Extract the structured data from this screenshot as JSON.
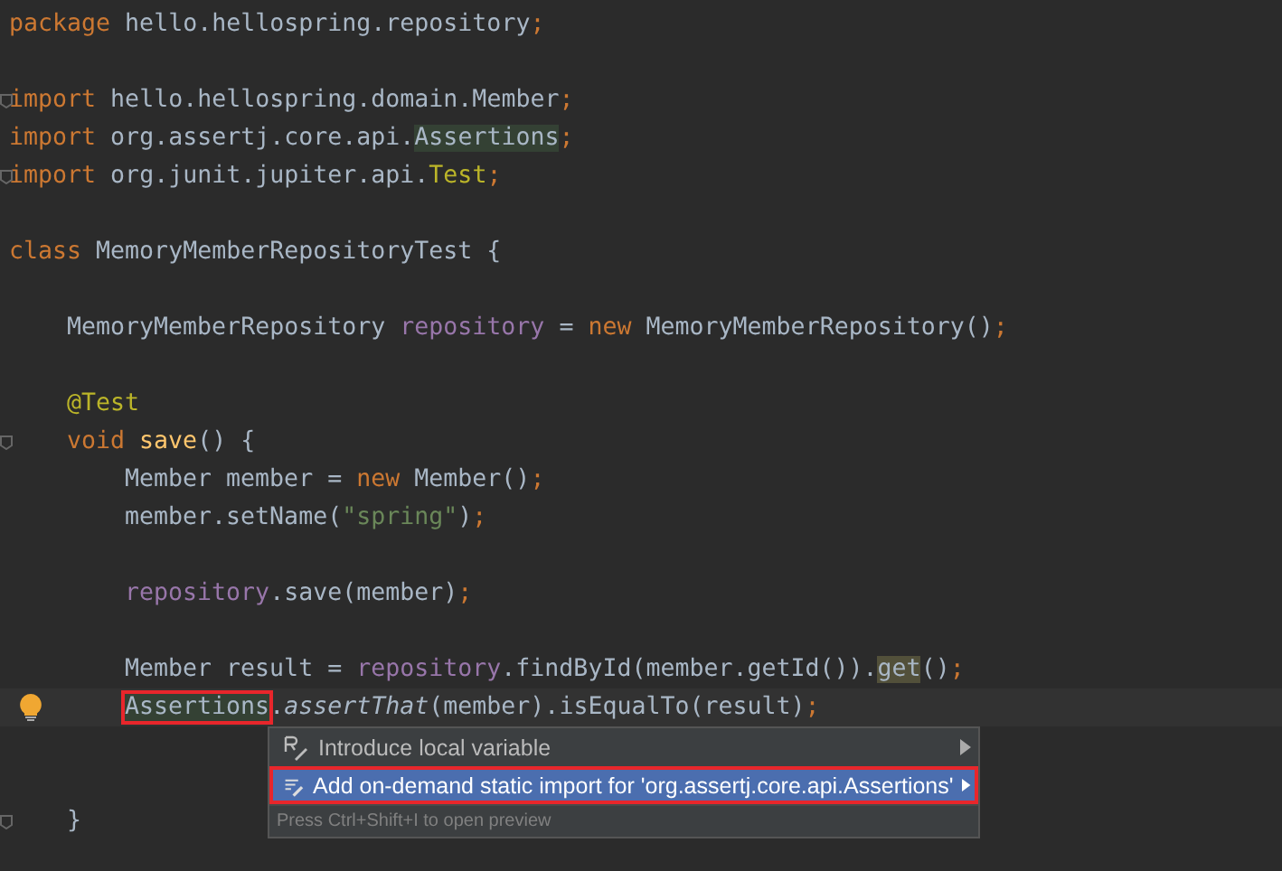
{
  "editor": {
    "lines": [
      {
        "kind": "code",
        "tokens": [
          {
            "t": "package",
            "kind": "keyword"
          },
          {
            "t": " hello.hellospring.repository",
            "kind": "plain"
          },
          {
            "t": ";",
            "kind": "punct"
          }
        ]
      },
      {
        "kind": "blank"
      },
      {
        "kind": "code",
        "fold": true,
        "tokens": [
          {
            "t": "import",
            "kind": "keyword"
          },
          {
            "t": " hello.hellospring.domain.Member",
            "kind": "plain"
          },
          {
            "t": ";",
            "kind": "punct"
          }
        ]
      },
      {
        "kind": "code",
        "tokens": [
          {
            "t": "import",
            "kind": "keyword"
          },
          {
            "t": " org.assertj.core.api.",
            "kind": "plain"
          },
          {
            "t": "Assertions",
            "kind": "usage"
          },
          {
            "t": ";",
            "kind": "punct"
          }
        ]
      },
      {
        "kind": "code",
        "fold": true,
        "tokens": [
          {
            "t": "import",
            "kind": "keyword"
          },
          {
            "t": " org.junit.jupiter.api.",
            "kind": "plain"
          },
          {
            "t": "Test",
            "kind": "annotation"
          },
          {
            "t": ";",
            "kind": "punct"
          }
        ]
      },
      {
        "kind": "blank"
      },
      {
        "kind": "code",
        "tokens": [
          {
            "t": "class",
            "kind": "keyword"
          },
          {
            "t": " MemoryMemberRepositoryTest {",
            "kind": "plain"
          }
        ],
        "children": [
          {
            "kind": "blank"
          },
          {
            "kind": "code",
            "tokens": [
              {
                "t": "MemoryMemberRepository ",
                "kind": "plain"
              },
              {
                "t": "repository",
                "kind": "field"
              },
              {
                "t": " = ",
                "kind": "plain"
              },
              {
                "t": "new",
                "kind": "keyword"
              },
              {
                "t": " MemoryMemberRepository()",
                "kind": "plain"
              },
              {
                "t": ";",
                "kind": "punct"
              }
            ]
          },
          {
            "kind": "blank"
          },
          {
            "kind": "code",
            "tokens": [
              {
                "t": "@Test",
                "kind": "annotation"
              }
            ]
          },
          {
            "kind": "code",
            "fold": true,
            "tokens": [
              {
                "t": "void",
                "kind": "keyword"
              },
              {
                "t": " save",
                "kind": "method"
              },
              {
                "t": "() {",
                "kind": "plain"
              }
            ],
            "children": [
              {
                "kind": "code",
                "tokens": [
                  {
                    "t": "Member member = ",
                    "kind": "plain"
                  },
                  {
                    "t": "new",
                    "kind": "keyword"
                  },
                  {
                    "t": " Member()",
                    "kind": "plain"
                  },
                  {
                    "t": ";",
                    "kind": "punct"
                  }
                ]
              },
              {
                "kind": "code",
                "tokens": [
                  {
                    "t": "member.setName(",
                    "kind": "plain"
                  },
                  {
                    "t": "\"spring\"",
                    "kind": "string"
                  },
                  {
                    "t": ")",
                    "kind": "plain"
                  },
                  {
                    "t": ";",
                    "kind": "punct"
                  }
                ]
              },
              {
                "kind": "blank"
              },
              {
                "kind": "code",
                "tokens": [
                  {
                    "t": "repository",
                    "kind": "field"
                  },
                  {
                    "t": ".save(member)",
                    "kind": "plain"
                  },
                  {
                    "t": ";",
                    "kind": "punct"
                  }
                ]
              },
              {
                "kind": "blank"
              },
              {
                "kind": "code",
                "tokens": [
                  {
                    "t": "Member result = ",
                    "kind": "plain"
                  },
                  {
                    "t": "repository",
                    "kind": "field"
                  },
                  {
                    "t": ".findById(member.getId()).",
                    "kind": "plain"
                  },
                  {
                    "t": "get",
                    "kind": "read"
                  },
                  {
                    "t": "()",
                    "kind": "plain"
                  },
                  {
                    "t": ";",
                    "kind": "punct"
                  }
                ]
              },
              {
                "kind": "code",
                "current": true,
                "bulb": true,
                "tokens": [
                  {
                    "t": "Assertions",
                    "kind": "boxed"
                  },
                  {
                    "t": ".",
                    "kind": "plain"
                  },
                  {
                    "t": "assertThat",
                    "kind": "italic"
                  },
                  {
                    "t": "(member).isEqualTo(result)",
                    "kind": "plain"
                  },
                  {
                    "t": ";",
                    "kind": "punct"
                  }
                ]
              },
              {
                "kind": "blank"
              },
              {
                "kind": "blank"
              }
            ]
          },
          {
            "kind": "code",
            "fold": true,
            "tokens": [
              {
                "t": "}",
                "kind": "plain"
              }
            ]
          }
        ]
      }
    ]
  },
  "popup": {
    "items": [
      {
        "label": "Introduce local variable",
        "kind": "variable",
        "selected": false
      },
      {
        "label": "Add on-demand static import for 'org.assertj.core.api.Assertions'",
        "kind": "import",
        "selected": true
      }
    ],
    "hint": "Press Ctrl+Shift+I to open preview"
  }
}
